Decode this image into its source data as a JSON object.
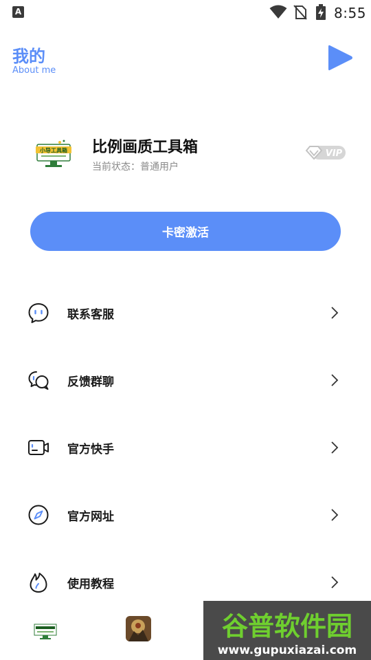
{
  "status_bar": {
    "left_icon_letter": "A",
    "time": "8:55"
  },
  "header": {
    "title": "我的",
    "subtitle": "About me"
  },
  "profile": {
    "app_name": "比例画质工具箱",
    "status_text": "当前状态：普通用户",
    "vip_label": "VIP",
    "avatar_logo_text": "小导工具箱"
  },
  "activate_button": {
    "label": "卡密激活"
  },
  "menu": {
    "items": [
      {
        "label": "联系客服",
        "icon": "chat-bubble-icon"
      },
      {
        "label": "反馈群聊",
        "icon": "group-chat-icon"
      },
      {
        "label": "官方快手",
        "icon": "video-camera-icon"
      },
      {
        "label": "官方网址",
        "icon": "compass-icon"
      },
      {
        "label": "使用教程",
        "icon": "flame-icon"
      }
    ]
  },
  "footer": {
    "watermark_title": "谷普软件园",
    "watermark_url": "www.gupuxiazai.com"
  },
  "colors": {
    "accent": "#5b8ef8",
    "watermark_green": "#6fcf2f",
    "watermark_bg": "#3b3b3b"
  }
}
